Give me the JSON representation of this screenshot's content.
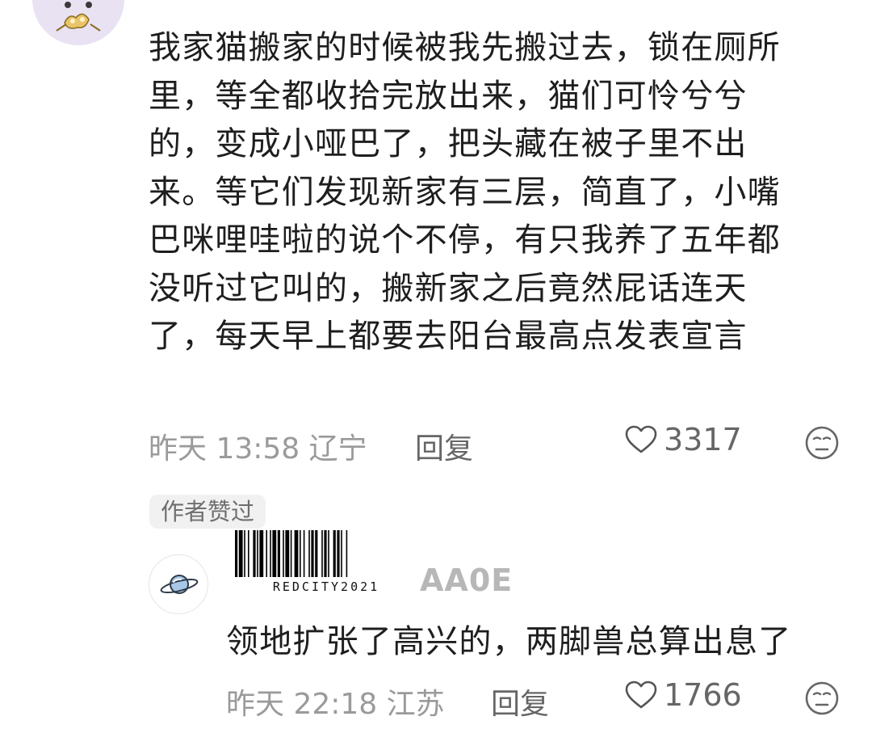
{
  "main_comment": {
    "lines": [
      "我家猫搬家的时候被我先搬过去，锁在厕所",
      "里，等全都收拾完放出来，猫们可怜兮兮",
      "的，变成小哑巴了，把头藏在被子里不出",
      "来。等它们发现新家有三层，简直了，小嘴",
      "巴咪哩哇啦的说个不停，有只我养了五年都",
      "没听过它叫的，搬新家之后竟然屁话连天",
      "了，每天早上都要去阳台最高点发表宣言"
    ],
    "time": "昨天 13:58 辽宁",
    "reply_label": "回复",
    "like_count": "3317",
    "avatar_icon": "cat-avatar-icon"
  },
  "author_liked_badge": "作者赞过",
  "reply": {
    "username_visible": "AA0E",
    "watermark_text": "REDCITY2021",
    "text": "领地扩张了高兴的，两脚兽总算出息了",
    "time": "昨天 22:18 江苏",
    "reply_label": "回复",
    "like_count": "1766",
    "avatar_icon": "planet-avatar-icon"
  },
  "colors": {
    "text_primary": "#1e1e1e",
    "text_secondary": "#9a9a9a",
    "badge_bg": "#f1f1f1"
  }
}
